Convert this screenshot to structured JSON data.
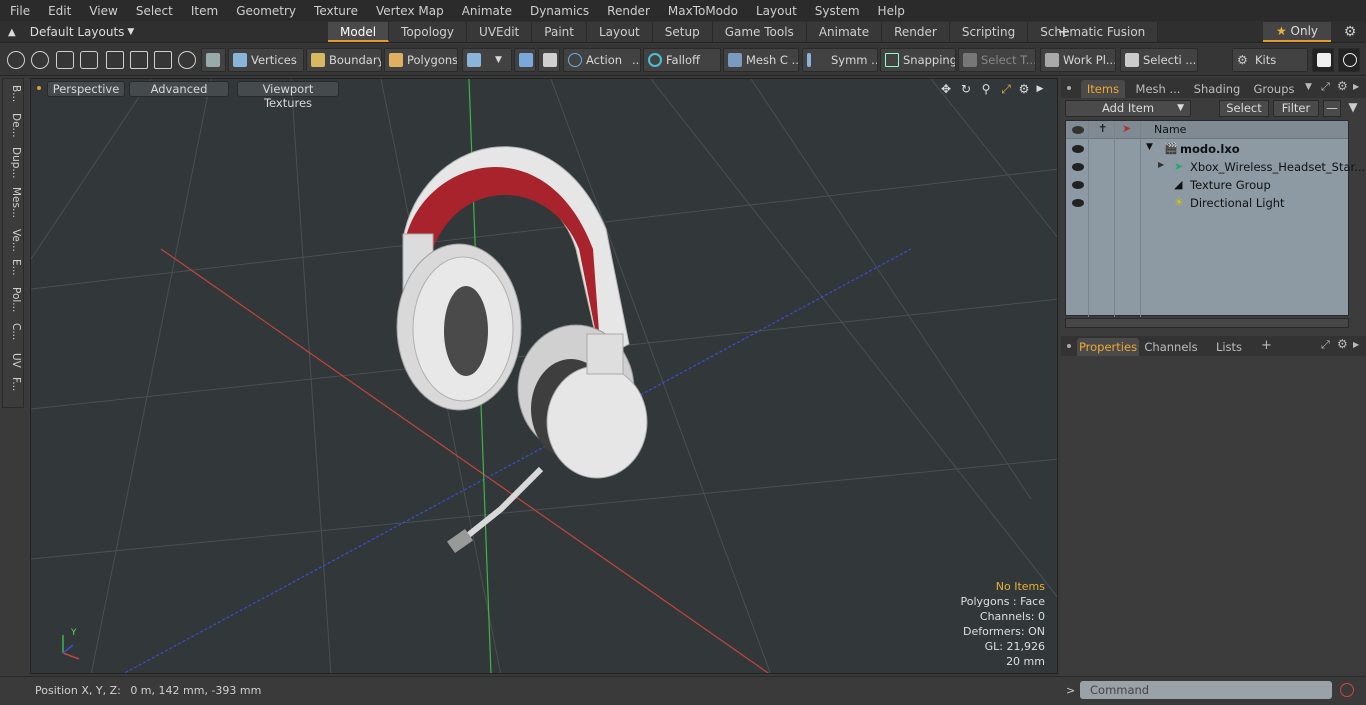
{
  "menu": [
    "File",
    "Edit",
    "View",
    "Select",
    "Item",
    "Geometry",
    "Texture",
    "Vertex Map",
    "Animate",
    "Dynamics",
    "Render",
    "MaxToModo",
    "Layout",
    "System",
    "Help"
  ],
  "layoutbar": {
    "layout_selector": "Default Layouts",
    "tabs": [
      "Model",
      "Topology",
      "UVEdit",
      "Paint",
      "Layout",
      "Setup",
      "Game Tools",
      "Animate",
      "Render",
      "Scripting",
      "Schematic Fusion"
    ],
    "active_tab": "Model",
    "plus": "+",
    "only_label": "Only"
  },
  "toolbar": {
    "vertices": "Vertices",
    "boundary": "Boundary",
    "polygons": "Polygons",
    "action": "Action",
    "falloff": "Falloff",
    "mesh_c": "Mesh C ...",
    "symm": "Symm ...",
    "snapping": "Snapping",
    "select_t": "Select T...",
    "work_pl": "Work Pl...",
    "selecti": "Selecti ...",
    "kits": "Kits"
  },
  "left_strip": [
    "B...",
    "De...",
    "Dup...",
    "Mes...",
    "Ve...",
    "E...",
    "Pol...",
    "C...",
    "UV",
    "F..."
  ],
  "viewport": {
    "tabs": [
      "Perspective",
      "Advanced",
      "Viewport Textures"
    ],
    "stats": {
      "no_items": "No Items",
      "polygons": "Polygons : Face",
      "channels": "Channels: 0",
      "deformers": "Deformers: ON",
      "gl": "GL: 21,926",
      "scale": "20 mm"
    },
    "axis_y": "Y"
  },
  "items_panel": {
    "tabs": [
      "Items",
      "Mesh ...",
      "Shading",
      "Groups"
    ],
    "add_item": "Add Item",
    "select": "Select",
    "filter": "Filter",
    "column_name": "Name",
    "rows": [
      {
        "name": "modo.lxo"
      },
      {
        "name": "Xbox_Wireless_Headset_Star..."
      },
      {
        "name": "Texture Group"
      },
      {
        "name": "Directional Light"
      }
    ]
  },
  "properties_panel": {
    "tabs": [
      "Properties",
      "Channels",
      "Lists"
    ],
    "plus": "+"
  },
  "statusbar": {
    "position_label": "Position X, Y, Z:",
    "position_value": "0 m, 142 mm, -393 mm",
    "command_placeholder": "Command"
  },
  "colors": {
    "accent": "#e49a2c",
    "viewport_bg": "#323739",
    "list_bg": "#8e9aa3"
  }
}
